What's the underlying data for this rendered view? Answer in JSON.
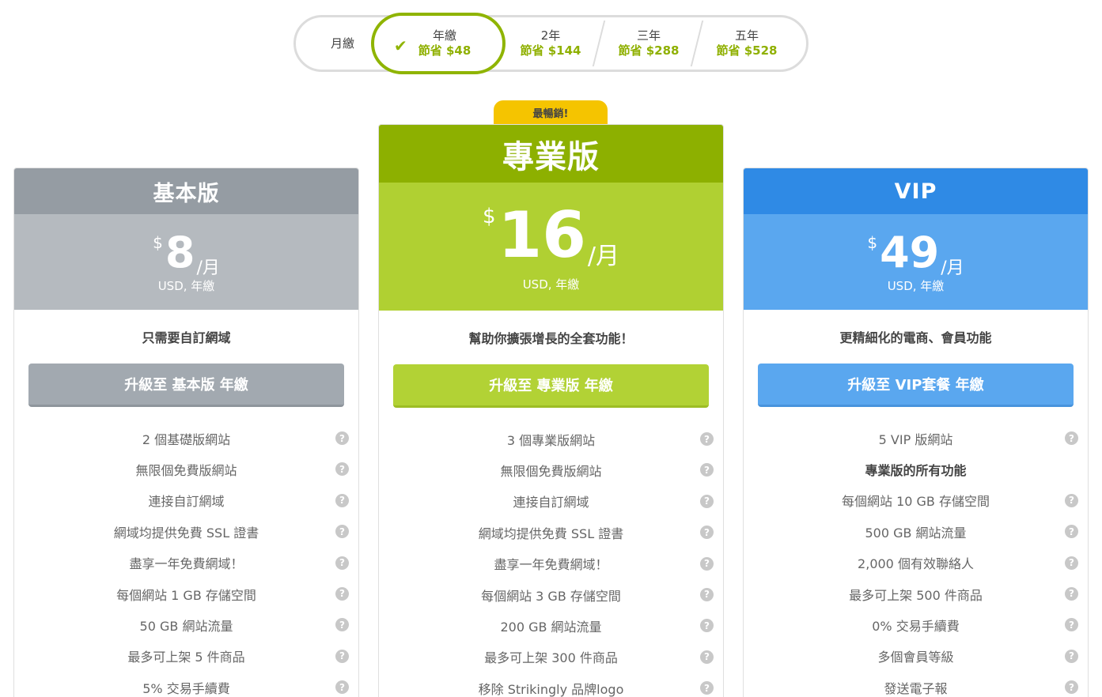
{
  "billing": {
    "options": [
      {
        "label": "月繳"
      },
      {
        "label": "年繳",
        "savings": "節省 $48",
        "selected": true
      },
      {
        "label": "2年",
        "savings": "節省 $144"
      },
      {
        "label": "三年",
        "savings": "節省 $288"
      },
      {
        "label": "五年",
        "savings": "節省 $528"
      }
    ]
  },
  "badge": "最暢銷!",
  "plans": [
    {
      "name": "基本版",
      "currency": "$",
      "price": "8",
      "per": "/月",
      "note": "USD, 年繳",
      "tagline": "只需要自訂網域",
      "cta": "升級至 基本版 年繳",
      "color": "#959ca3",
      "features": [
        "2 個基礎版網站",
        "無限個免費版網站",
        "連接自訂網域",
        "網域均提供免費 SSL 證書",
        "盡享一年免費網域！",
        "每個網站 1 GB 存儲空間",
        "50 GB 網站流量",
        "最多可上架 5 件商品",
        "5% 交易手續費"
      ]
    },
    {
      "name": "專業版",
      "currency": "$",
      "price": "16",
      "per": "/月",
      "note": "USD, 年繳",
      "tagline": "幫助你擴張增長的全套功能！",
      "cta": "升級至 專業版 年繳",
      "color": "#8db000",
      "features": [
        "3 個專業版網站",
        "無限個免費版網站",
        "連接自訂網域",
        "網域均提供免費 SSL 證書",
        "盡享一年免費網域！",
        "每個網站 3 GB 存儲空間",
        "200 GB 網站流量",
        "最多可上架 300 件商品",
        "移除 Strikingly 品牌logo"
      ]
    },
    {
      "name": "VIP",
      "currency": "$",
      "price": "49",
      "per": "/月",
      "note": "USD, 年繳",
      "tagline": "更精細化的電商、會員功能",
      "cta": "升級至 VIP套餐 年繳",
      "color": "#2f8ae5",
      "features": [
        "5 VIP 版網站",
        "專業版的所有功能",
        "每個網站 10 GB 存儲空間",
        "500 GB 網站流量",
        "2,000 個有效聯絡人",
        "最多可上架 500 件商品",
        "0% 交易手續費",
        "多個會員等級",
        "發送電子報"
      ]
    }
  ],
  "help_icon": "?"
}
